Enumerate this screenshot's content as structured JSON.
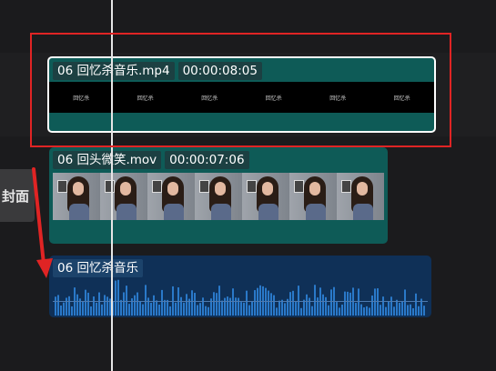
{
  "tracks": {
    "cover_label": "封面",
    "clips": {
      "music_clip": {
        "name": "06 回忆杀音乐.mp4",
        "duration": "00:00:08:05",
        "thumb_label": "回忆杀"
      },
      "video_clip": {
        "name": "06 回头微笑.mov",
        "duration": "00:00:07:06"
      },
      "audio_clip": {
        "name": "06 回忆杀音乐"
      }
    }
  },
  "colors": {
    "background": "#1b1b1d",
    "video_clip": "#0e5b57",
    "audio_clip": "#0f3057",
    "waveform": "#2a79c9",
    "annotation": "#e02424",
    "playhead": "#e6e6e6"
  }
}
